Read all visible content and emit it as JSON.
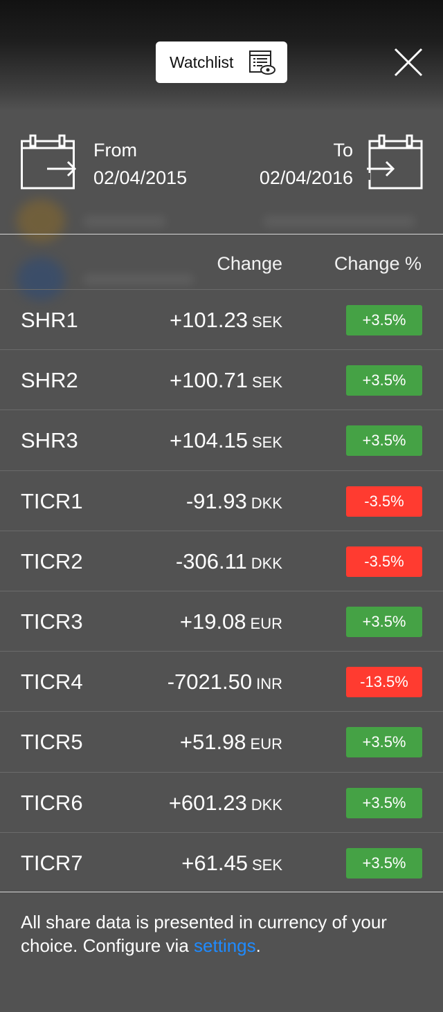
{
  "header": {
    "watchlist_label": "Watchlist"
  },
  "date_range": {
    "from_label": "From",
    "from_date": "02/04/2015",
    "to_label": "To",
    "to_date": "02/04/2016"
  },
  "columns": {
    "change": "Change",
    "change_pct": "Change %"
  },
  "rows": [
    {
      "ticker": "SHR1",
      "change": "+101.23",
      "currency": "SEK",
      "pct": "+3.5%",
      "direction": "up"
    },
    {
      "ticker": "SHR2",
      "change": "+100.71",
      "currency": "SEK",
      "pct": "+3.5%",
      "direction": "up"
    },
    {
      "ticker": "SHR3",
      "change": "+104.15",
      "currency": "SEK",
      "pct": "+3.5%",
      "direction": "up"
    },
    {
      "ticker": "TICR1",
      "change": "-91.93",
      "currency": "DKK",
      "pct": "-3.5%",
      "direction": "down"
    },
    {
      "ticker": "TICR2",
      "change": "-306.11",
      "currency": "DKK",
      "pct": "-3.5%",
      "direction": "down"
    },
    {
      "ticker": "TICR3",
      "change": "+19.08",
      "currency": "EUR",
      "pct": "+3.5%",
      "direction": "up"
    },
    {
      "ticker": "TICR4",
      "change": "-7021.50",
      "currency": "INR",
      "pct": "-13.5%",
      "direction": "down"
    },
    {
      "ticker": "TICR5",
      "change": "+51.98",
      "currency": "EUR",
      "pct": "+3.5%",
      "direction": "up"
    },
    {
      "ticker": "TICR6",
      "change": "+601.23",
      "currency": "DKK",
      "pct": "+3.5%",
      "direction": "up"
    },
    {
      "ticker": "TICR7",
      "change": "+61.45",
      "currency": "SEK",
      "pct": "+3.5%",
      "direction": "up"
    }
  ],
  "footer": {
    "text_before": "All share data is presented in currency of your choice. Configure via ",
    "link_text": "settings",
    "text_after": "."
  },
  "colors": {
    "up": "#45a245",
    "down": "#ff3b30",
    "link": "#1f8bff"
  },
  "icons": {
    "watchlist": "watchlist-eye-icon",
    "close": "close-icon",
    "from": "calendar-arrow-in-icon",
    "to": "calendar-arrow-out-icon"
  }
}
